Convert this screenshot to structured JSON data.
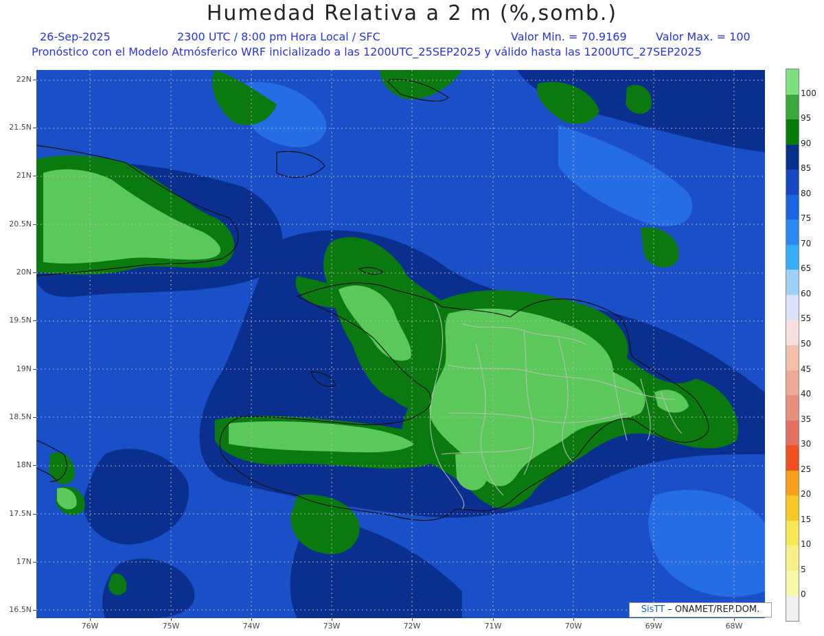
{
  "title": "Humedad Relativa a 2 m (%,somb.)",
  "header": {
    "date": "26-Sep-2025",
    "time": "2300 UTC / 8:00 pm Hora Local / SFC",
    "min": "Valor Min. = 70.9169",
    "max": "Valor Max. = 100",
    "model": "Pronóstico con el Modelo Atmósferico WRF inicializado a las 1200UTC_25SEP2025 y válido hasta las  1200UTC_27SEP2025"
  },
  "lat_labels": [
    "22N",
    "21.5N",
    "21N",
    "20.5N",
    "20N",
    "19.5N",
    "19N",
    "18.5N",
    "18N",
    "17.5N",
    "17N",
    "16.5N"
  ],
  "lon_labels": [
    "76W",
    "75W",
    "74W",
    "73W",
    "72W",
    "71W",
    "70W",
    "69W",
    "68W"
  ],
  "colorbar": {
    "labels": [
      "100",
      "95",
      "90",
      "85",
      "80",
      "75",
      "70",
      "65",
      "60",
      "55",
      "50",
      "45",
      "40",
      "35",
      "30",
      "25",
      "20",
      "15",
      "10",
      "5",
      "0"
    ],
    "colors": [
      "#7ee07e",
      "#3aa83a",
      "#087a08",
      "#05318a",
      "#1547c0",
      "#1a66e0",
      "#2a88f0",
      "#34aff8",
      "#9ed0f8",
      "#d8e2f8",
      "#f8e0e0",
      "#f4c0a8",
      "#eca898",
      "#e89080",
      "#e47060",
      "#f05020",
      "#f8a018",
      "#f8c828",
      "#f8e858",
      "#f8f088",
      "#f8f8a8",
      "#f0f0f0"
    ]
  },
  "credit": {
    "brand": "SisTT",
    "rest": " – ONAMET/REP.DOM."
  }
}
